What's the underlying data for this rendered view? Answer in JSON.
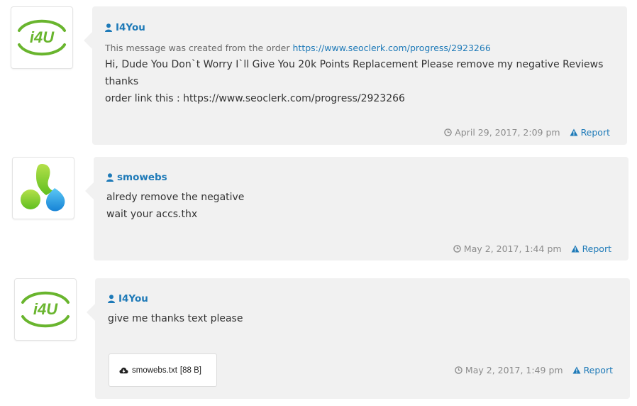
{
  "messages": [
    {
      "author": "I4You",
      "avatar": "i4u-logo",
      "origin_prefix": "This message was created from the order",
      "origin_link": "https://www.seoclerk.com/progress/2923266",
      "lines": [
        "Hi, Dude You Don`t Worry I`ll Give You 20k Points Replacement Please remove my negative Reviews",
        "thanks",
        "order link this : https://www.seoclerk.com/progress/2923266"
      ],
      "timestamp": "April 29, 2017, 2:09 pm",
      "report_label": "Report"
    },
    {
      "author": "smowebs",
      "avatar": "smowebs-logo",
      "lines": [
        "alredy remove the negative",
        "wait your accs.thx"
      ],
      "timestamp": "May 2, 2017, 1:44 pm",
      "report_label": "Report"
    },
    {
      "author": "I4You",
      "avatar": "i4u-logo",
      "lines": [
        "give me thanks text please"
      ],
      "attachment": {
        "filename": "smowebs.txt",
        "size": "[88 B]",
        "icon": "cloud-download-icon"
      },
      "timestamp": "May 2, 2017, 1:49 pm",
      "report_label": "Report"
    }
  ],
  "logo_texts": {
    "i4u": "i4U"
  },
  "colors": {
    "link": "#1e7ab8",
    "bubble": "#f1f1f1",
    "meta": "#8c8c8c",
    "i4u_green": "#69b52e",
    "smowebs_green": "#8fd12b",
    "smowebs_blue": "#1fa3e8"
  }
}
